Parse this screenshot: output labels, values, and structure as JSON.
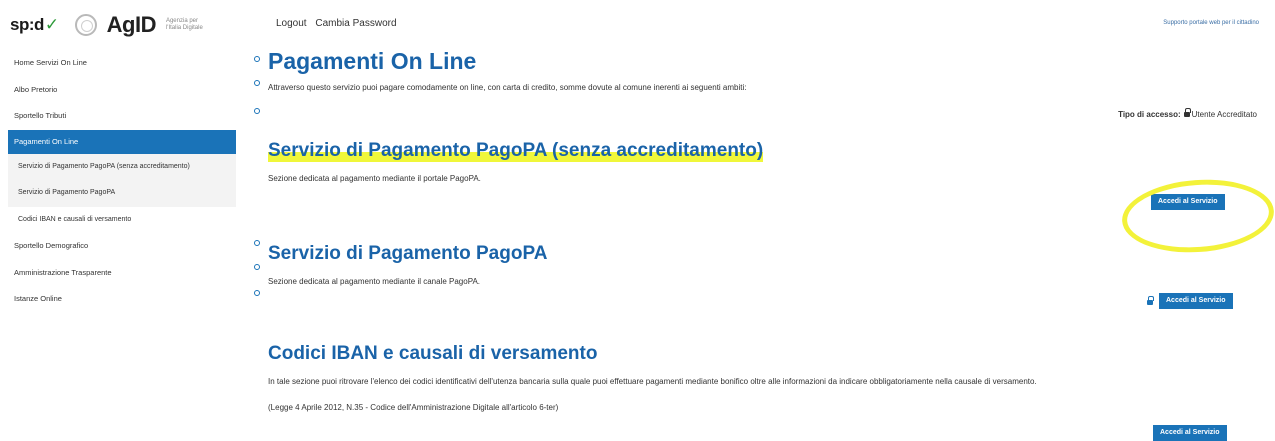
{
  "brand": {
    "spid": "sp:d",
    "agid": "AgID",
    "agid_sub": "Agenzia per l'Italia Digitale"
  },
  "topnav": {
    "logout": "Logout",
    "change_password": "Cambia Password"
  },
  "support_link": "Supporto portale web per il cittadino",
  "sidebar": {
    "items": [
      {
        "label": "Home Servizi On Line"
      },
      {
        "label": "Albo Pretorio"
      },
      {
        "label": "Sportello Tributi"
      },
      {
        "label": "Pagamenti On Line"
      },
      {
        "label": "Servizio di Pagamento PagoPA (senza accreditamento)"
      },
      {
        "label": "Servizio di Pagamento PagoPA"
      },
      {
        "label": "Codici IBAN e causali di versamento"
      },
      {
        "label": "Sportello Demografico"
      },
      {
        "label": "Amministrazione Trasparente"
      },
      {
        "label": "Istanze Online"
      }
    ]
  },
  "page": {
    "title": "Pagamenti On Line",
    "intro": "Attraverso questo servizio puoi pagare comodamente on line, con carta di credito, somme dovute al comune inerenti ai seguenti ambiti:",
    "access_label": "Tipo di accesso:",
    "access_value": "Utente Accreditato"
  },
  "sections": [
    {
      "title": "Servizio di Pagamento PagoPA (senza accreditamento)",
      "desc": "Sezione dedicata al pagamento mediante il portale PagoPA.",
      "button": "Accedi al Servizio"
    },
    {
      "title": "Servizio di Pagamento PagoPA",
      "desc": "Sezione dedicata al pagamento mediante il canale PagoPA.",
      "button": "Accedi al Servizio"
    },
    {
      "title": "Codici IBAN e causali di versamento",
      "desc": "In tale sezione puoi ritrovare l'elenco dei codici identificativi dell'utenza bancaria sulla quale puoi effettuare pagamenti mediante bonifico oltre alle informazioni da indicare obbligatoriamente nella causale di versamento.",
      "note": "(Legge 4 Aprile 2012, N.35 - Codice dell'Amministrazione Digitale all'articolo 6-ter)",
      "button": "Accedi al Servizio"
    }
  ],
  "colors": {
    "accent": "#1a73b8",
    "title": "#1a63a8",
    "highlight": "#f3f23a"
  }
}
